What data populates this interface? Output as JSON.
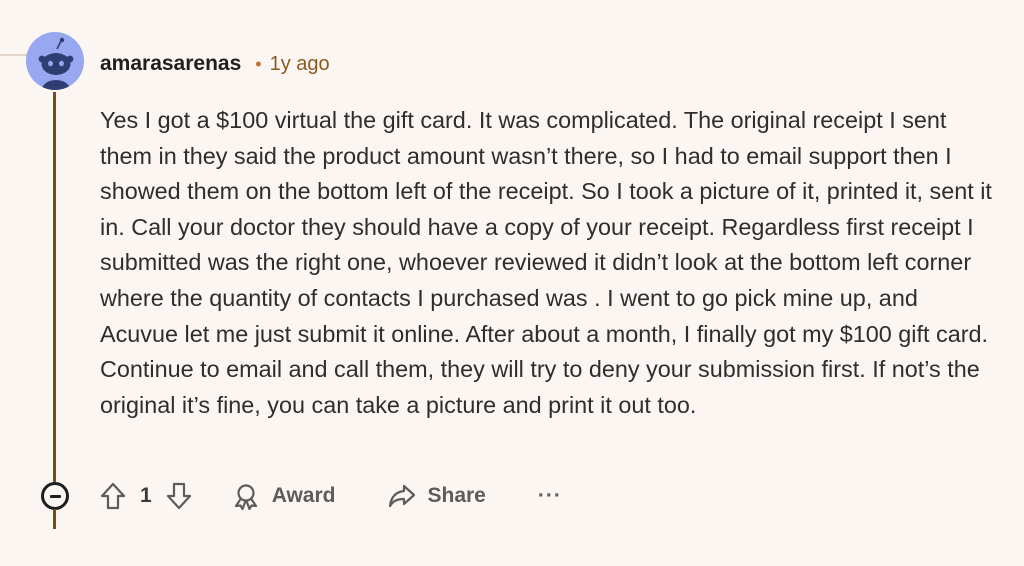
{
  "comment": {
    "author": "amarasarenas",
    "separator": "•",
    "time_ago": "1y ago",
    "body": "Yes I got a $100 virtual the gift card. It was complicated. The original receipt I sent them in they said the product amount wasn’t there, so I had to email support then I showed them on the bottom left of the receipt. So I took a picture of it, printed it, sent it in. Call your doctor they should have a copy of your receipt. Regardless first receipt I submitted was the right one, whoever reviewed it didn’t look at the bottom left corner where the quantity of contacts I purchased was . I went to go pick mine up, and Acuvue let me just submit it online. After about a month, I finally got my $100 gift card. Continue to email and call them, they will try to deny your submission first. If not’s the original it’s fine, you can take a picture and print it out too."
  },
  "actions": {
    "score": "1",
    "award_label": "Award",
    "share_label": "Share",
    "more_label": "···"
  },
  "icons": {
    "avatar": "snoo-avatar-icon",
    "collapse": "collapse-minus-icon",
    "upvote": "upvote-arrow-icon",
    "downvote": "downvote-arrow-icon",
    "award": "award-ribbon-icon",
    "share": "share-arrow-icon"
  },
  "colors": {
    "background": "#fcf6f3",
    "thread_line": "#7a4a18",
    "timestamp": "#8a5a20",
    "avatar_bg": "#97a7f0"
  }
}
